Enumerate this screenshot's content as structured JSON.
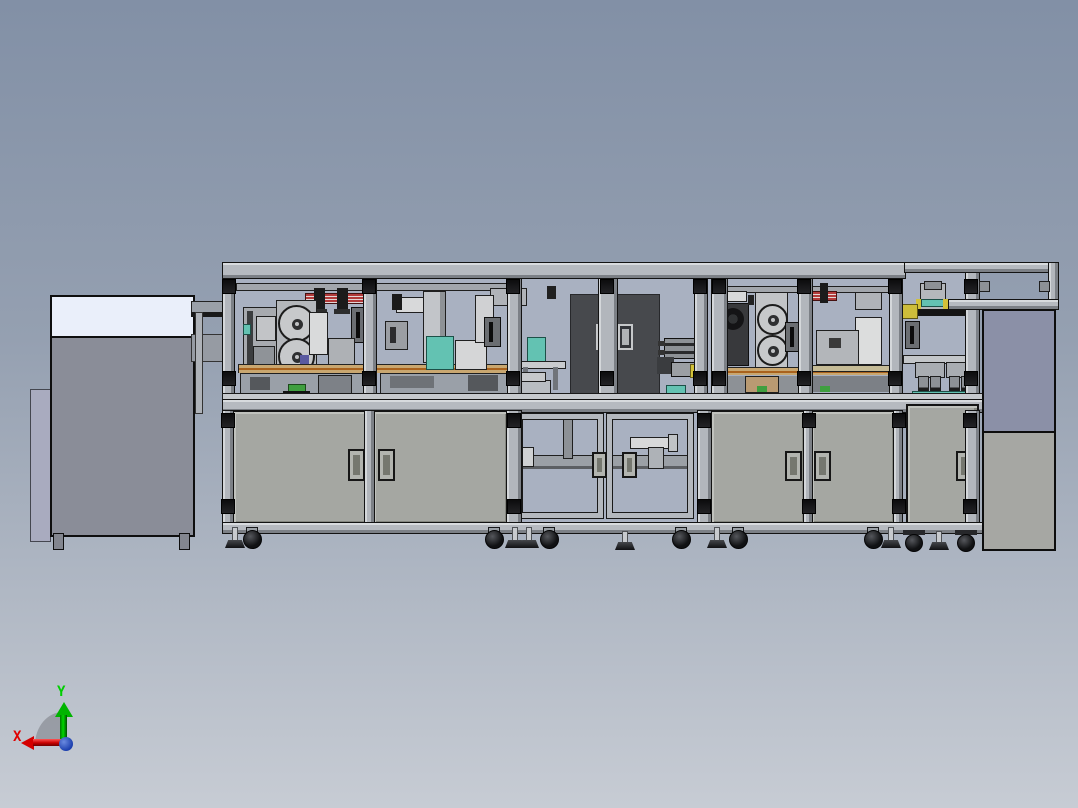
{
  "viewport": {
    "type": "cad-3d-model-view",
    "background_top": "#8290a6",
    "background_bottom": "#c7ccd4"
  },
  "triad": {
    "x_label": "X",
    "y_label": "Y",
    "x_axis_color": "#d40000",
    "y_axis_color": "#00b400",
    "origin_color": "#2b4fc0"
  },
  "model_colors": {
    "frame_aluminum": "#b6bac0",
    "glass_panel": "#a9b1c1",
    "cabinet_door": "#a5a7a2",
    "dark_enclosure": "#47494d",
    "teal_accent": "#63c2b2",
    "conveyor_tan": "#c9a770",
    "stripe_red": "#b23a3a",
    "safety_yellow": "#d3c23a",
    "left_cabinet_top": "#eaeffa",
    "left_cabinet_body": "#8a8d98",
    "right_cabinet_upper": "#8b90a7",
    "right_cabinet_lower": "#a6a7a3"
  }
}
